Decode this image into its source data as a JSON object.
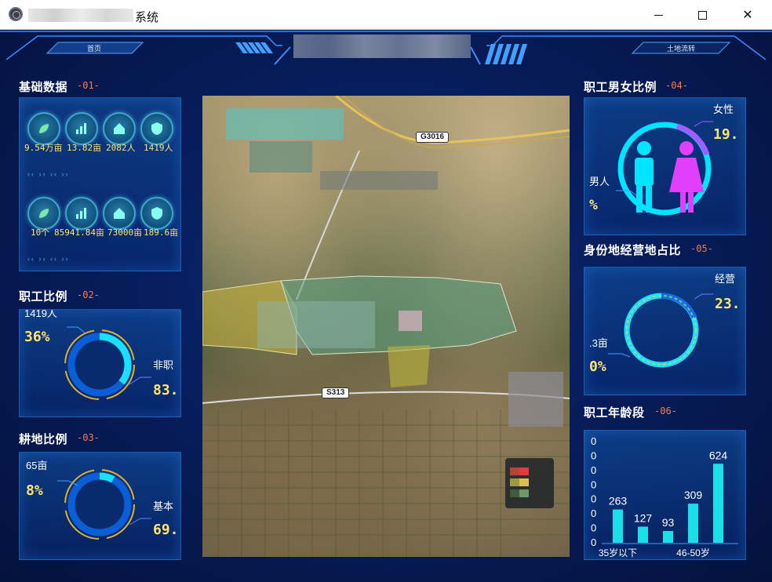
{
  "window": {
    "title_suffix": "系统"
  },
  "nav": {
    "home": "首页",
    "land_transfer": "土地流转"
  },
  "sections": {
    "basic_data": {
      "title": "基础数据",
      "num": "-01-"
    },
    "staff_ratio": {
      "title": "职工比例",
      "num": "-02-"
    },
    "farmland_ratio": {
      "title": "耕地比例",
      "num": "-03-"
    },
    "gender_ratio": {
      "title": "职工男女比例",
      "num": "-04-"
    },
    "identity_ratio": {
      "title": "身份地经营地占比",
      "num": "-05-"
    },
    "age_group": {
      "title": "职工年龄段",
      "num": "-06-"
    }
  },
  "basic_data": {
    "row1": [
      "9.54万亩",
      "13.82亩",
      "2082人",
      "1419人"
    ],
    "row2": [
      "10个",
      "85941.84亩",
      "73000亩",
      "189.6亩"
    ],
    "chevrons": "‹‹ ›› ‹‹ ››"
  },
  "staff_ratio": {
    "left_label": "1419人",
    "left_pct": "36%",
    "right_label": "非职",
    "right_pct": "83."
  },
  "farmland_ratio": {
    "left_label": "65亩",
    "left_pct": "8%",
    "right_label": "基本",
    "right_pct": "69."
  },
  "gender_ratio": {
    "right_label": "女性",
    "right_pct": "19.",
    "left_label": "男人",
    "left_pct": "%"
  },
  "identity_ratio": {
    "right_label": "经营",
    "right_pct": "23.",
    "left_label": ".3亩",
    "left_pct": "0%"
  },
  "map": {
    "road1": "G3016",
    "road2": "S313"
  },
  "colors": {
    "accent_cyan": "#19e0ff",
    "accent_yellow": "#ffe46a",
    "section_num": "#ff7b4a",
    "male": "#00e5ff",
    "female": "#e040fb"
  },
  "chart_data": {
    "type": "bar",
    "title": "",
    "categories": [
      "35岁以下",
      "",
      "",
      "46-50岁",
      ""
    ],
    "values": [
      263,
      127,
      93,
      309,
      624
    ],
    "tick_labels": [
      "0",
      "0",
      "0",
      "0",
      "0",
      "0",
      "0",
      "0"
    ],
    "ylim": [
      0,
      700
    ],
    "grid": false
  }
}
